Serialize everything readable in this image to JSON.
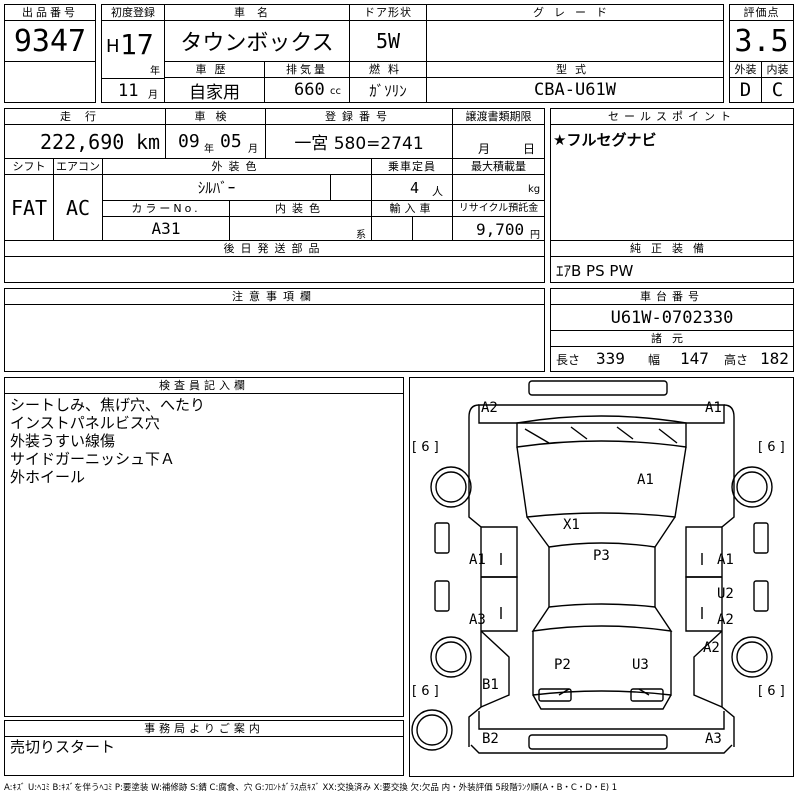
{
  "top": {
    "lot_no_label": "出品番号",
    "lot_no": "9347",
    "first_reg_label": "初度登録",
    "era": "H",
    "year": "17",
    "year_unit": "年",
    "month": "11",
    "month_unit": "月",
    "car_name_label": "車名",
    "car_name": "タウンボックス",
    "door_label": "ドア形状",
    "door": "5W",
    "grade_label": "グレード",
    "grade": "",
    "score_label": "評価点",
    "score": "3.5",
    "history_label": "車歴",
    "history": "自家用",
    "disp_label": "排気量",
    "disp": "660",
    "disp_unit": "cc",
    "fuel_label": "燃料",
    "fuel": "ｶﾞｿﾘﾝ",
    "model_label": "型式",
    "model": "CBA-U61W",
    "ext_label": "外装",
    "ext": "D",
    "int_label": "内装",
    "int": "C"
  },
  "second": {
    "mileage_label": "走行",
    "mileage": "222,690",
    "mileage_unit": "km",
    "inspection_label": "車検",
    "insp_year": "09",
    "insp_year_unit": "年",
    "insp_month": "05",
    "insp_month_unit": "月",
    "plate_label": "登録番号",
    "plate": "一宮 580=2741",
    "transfer_label": "譲渡書類期限",
    "transfer_month_unit": "月",
    "transfer_day_unit": "日",
    "shift_label": "シフト",
    "shift": "FAT",
    "ac_label": "エアコン",
    "ac": "AC",
    "color_label": "外装色",
    "color": "ｼﾙﾊﾞｰ",
    "seats_label": "乗車定員",
    "seats": "4",
    "seats_unit": "人",
    "load_label": "最大積載量",
    "load_unit": "kg",
    "color_no_label": "カラーNo.",
    "color_no": "A31",
    "int_color_label": "内装色",
    "int_color_unit": "系",
    "import_label": "輸入車",
    "recycle_label": "リサイクル預託金",
    "recycle": "9,700",
    "recycle_unit": "円",
    "later_label": "後日発送部品"
  },
  "sales": {
    "label": "セールスポイント",
    "text": "★フルセグナビ"
  },
  "equipment": {
    "label": "純正装備",
    "text": "ｴｱB PS PW"
  },
  "notes": {
    "label": "注意事項欄"
  },
  "chassis": {
    "label": "車台番号",
    "number": "U61W-0702330",
    "dims_label": "諸元",
    "len_label": "長さ",
    "len": "339",
    "width_label": "幅",
    "width": "147",
    "height_label": "高さ",
    "height": "182"
  },
  "inspector": {
    "label": "検査員記入欄",
    "lines": [
      "シートしみ、焦げ穴、へたり",
      "インストパネルビス穴",
      "外装うすい線傷",
      "サイドガーニッシュ下Ａ",
      "外ホイール"
    ]
  },
  "office": {
    "label": "事務局よりご案内",
    "text": "売切りスタート"
  },
  "diagram": {
    "marks": {
      "front_left": "A2",
      "front_right": "A1",
      "hood": "A1",
      "windshield": "X1",
      "roof": "P3",
      "left_front_door": "A1",
      "right_front_door": "A1",
      "left_rear": "A3",
      "right_mid": "U2",
      "right_rear_door": "A2",
      "right_rear_quarter": "A2",
      "rear_left_panel": "P2",
      "rear_right_panel": "U3",
      "left_back_corner": "B1",
      "rear_bumper_left": "B2",
      "rear_bumper_right": "A3"
    },
    "tire_left_top": "[ 6 ]",
    "tire_right_top": "[ 6 ]",
    "tire_left_bottom": "[ 6 ]",
    "tire_right_bottom": "[ 6 ]"
  },
  "legend": "A:ｷｽﾞ U:ﾍｺﾐ B:ｷｽﾞを伴うﾍｺﾐ P:要塗装 W:補修跡 S:錆 C:腐食、穴 G:ﾌﾛﾝﾄｶﾞﾗｽ点ｷｽﾞ XX:交換済み X:要交換 欠:欠品 内・外装評価 5段階ﾗﾝｸ順(A・B・C・D・E) 1"
}
